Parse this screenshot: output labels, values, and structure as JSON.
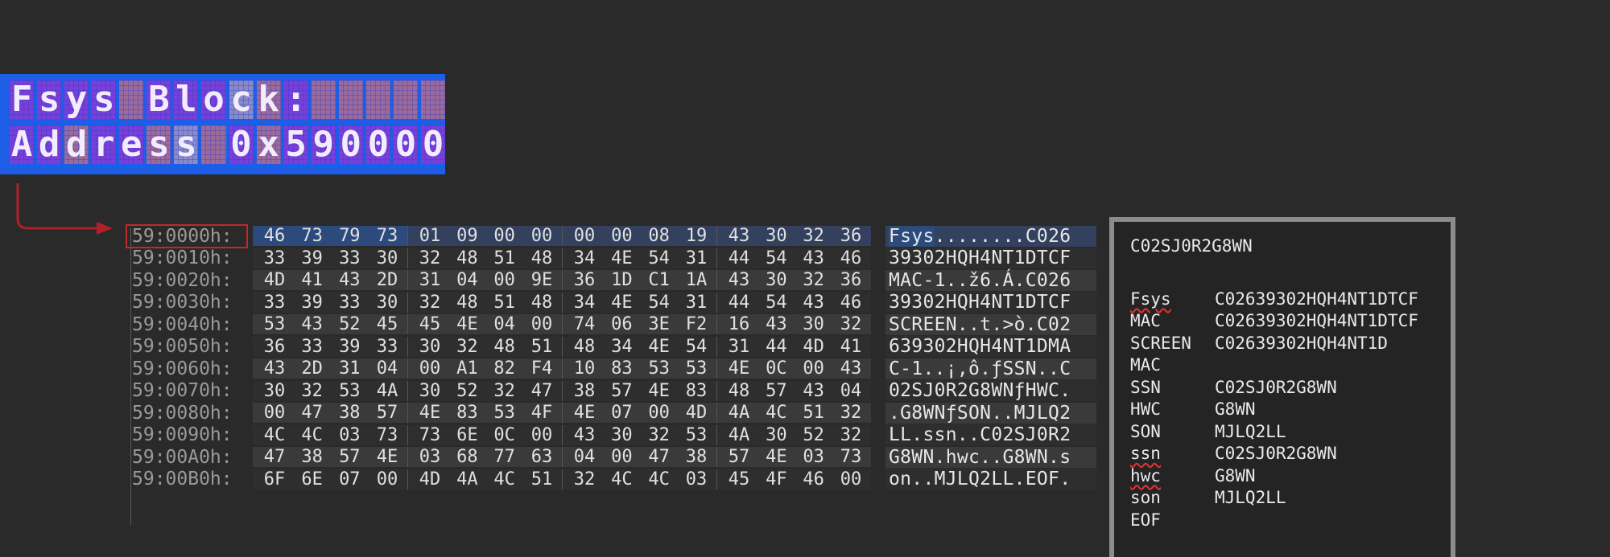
{
  "lcd": {
    "line1": [
      "F",
      "s",
      "y",
      "s",
      " ",
      "B",
      "l",
      "o",
      "c",
      "k",
      ":",
      " ",
      " ",
      " ",
      " ",
      " "
    ],
    "line2": [
      "A",
      "d",
      "d",
      "r",
      "e",
      "s",
      "s",
      " ",
      "0",
      "x",
      "5",
      "9",
      "0",
      "0",
      "0",
      "0"
    ]
  },
  "hex": {
    "rows": [
      {
        "addr": "59:0000h:",
        "bytes": [
          "46",
          "73",
          "79",
          "73",
          "01",
          "09",
          "00",
          "00",
          "00",
          "00",
          "08",
          "19",
          "43",
          "30",
          "32",
          "36"
        ],
        "ascii_hl": "Fsys",
        "ascii": "........C026"
      },
      {
        "addr": "59:0010h:",
        "bytes": [
          "33",
          "39",
          "33",
          "30",
          "32",
          "48",
          "51",
          "48",
          "34",
          "4E",
          "54",
          "31",
          "44",
          "54",
          "43",
          "46"
        ],
        "ascii_hl": "",
        "ascii": "39302HQH4NT1DTCF"
      },
      {
        "addr": "59:0020h:",
        "bytes": [
          "4D",
          "41",
          "43",
          "2D",
          "31",
          "04",
          "00",
          "9E",
          "36",
          "1D",
          "C1",
          "1A",
          "43",
          "30",
          "32",
          "36"
        ],
        "ascii_hl": "",
        "ascii": "MAC-1..ž6.Á.C026"
      },
      {
        "addr": "59:0030h:",
        "bytes": [
          "33",
          "39",
          "33",
          "30",
          "32",
          "48",
          "51",
          "48",
          "34",
          "4E",
          "54",
          "31",
          "44",
          "54",
          "43",
          "46"
        ],
        "ascii_hl": "",
        "ascii": "39302HQH4NT1DTCF"
      },
      {
        "addr": "59:0040h:",
        "bytes": [
          "53",
          "43",
          "52",
          "45",
          "45",
          "4E",
          "04",
          "00",
          "74",
          "06",
          "3E",
          "F2",
          "16",
          "43",
          "30",
          "32"
        ],
        "ascii_hl": "",
        "ascii": "SCREEN..t.>ò.C02"
      },
      {
        "addr": "59:0050h:",
        "bytes": [
          "36",
          "33",
          "39",
          "33",
          "30",
          "32",
          "48",
          "51",
          "48",
          "34",
          "4E",
          "54",
          "31",
          "44",
          "4D",
          "41"
        ],
        "ascii_hl": "",
        "ascii": "639302HQH4NT1DMA"
      },
      {
        "addr": "59:0060h:",
        "bytes": [
          "43",
          "2D",
          "31",
          "04",
          "00",
          "A1",
          "82",
          "F4",
          "10",
          "83",
          "53",
          "53",
          "4E",
          "0C",
          "00",
          "43"
        ],
        "ascii_hl": "",
        "ascii": "C-1..¡,ô.ƒSSN..C"
      },
      {
        "addr": "59:0070h:",
        "bytes": [
          "30",
          "32",
          "53",
          "4A",
          "30",
          "52",
          "32",
          "47",
          "38",
          "57",
          "4E",
          "83",
          "48",
          "57",
          "43",
          "04"
        ],
        "ascii_hl": "",
        "ascii": "02SJ0R2G8WNƒHWC."
      },
      {
        "addr": "59:0080h:",
        "bytes": [
          "00",
          "47",
          "38",
          "57",
          "4E",
          "83",
          "53",
          "4F",
          "4E",
          "07",
          "00",
          "4D",
          "4A",
          "4C",
          "51",
          "32"
        ],
        "ascii_hl": "",
        "ascii": ".G8WNƒSON..MJLQ2"
      },
      {
        "addr": "59:0090h:",
        "bytes": [
          "4C",
          "4C",
          "03",
          "73",
          "73",
          "6E",
          "0C",
          "00",
          "43",
          "30",
          "32",
          "53",
          "4A",
          "30",
          "52",
          "32"
        ],
        "ascii_hl": "",
        "ascii": "LL.ssn..C02SJ0R2"
      },
      {
        "addr": "59:00A0h:",
        "bytes": [
          "47",
          "38",
          "57",
          "4E",
          "03",
          "68",
          "77",
          "63",
          "04",
          "00",
          "47",
          "38",
          "57",
          "4E",
          "03",
          "73"
        ],
        "ascii_hl": "",
        "ascii": "G8WN.hwc..G8WN.s"
      },
      {
        "addr": "59:00B0h:",
        "bytes": [
          "6F",
          "6E",
          "07",
          "00",
          "4D",
          "4A",
          "4C",
          "51",
          "32",
          "4C",
          "4C",
          "03",
          "45",
          "4F",
          "46",
          "00"
        ],
        "ascii_hl": "",
        "ascii": "on..MJLQ2LL.EOF."
      }
    ]
  },
  "info": {
    "serial": "C02SJ0R2G8WN",
    "fields": [
      {
        "key": "Fsys",
        "value": "C02639302HQH4NT1DTCF",
        "squiggle": true
      },
      {
        "key": "MAC",
        "value": "C02639302HQH4NT1DTCF",
        "squiggle": false
      },
      {
        "key": "SCREEN",
        "value": "C02639302HQH4NT1D",
        "squiggle": false
      },
      {
        "key": "MAC",
        "value": "",
        "squiggle": false
      },
      {
        "key": "SSN",
        "value": "C02SJ0R2G8WN",
        "squiggle": false
      },
      {
        "key": "HWC",
        "value": "G8WN",
        "squiggle": false
      },
      {
        "key": "SON",
        "value": "MJLQ2LL",
        "squiggle": false
      },
      {
        "key": "ssn",
        "value": "C02SJ0R2G8WN",
        "squiggle": true
      },
      {
        "key": "hwc",
        "value": "G8WN",
        "squiggle": true
      },
      {
        "key": "son",
        "value": "MJLQ2LL",
        "squiggle": false
      },
      {
        "key": "EOF",
        "value": "",
        "squiggle": false
      }
    ]
  },
  "colors": {
    "lcd_bg": "#1e5ee6",
    "arrow": "#b0202a",
    "highlight": "#2d4a7c"
  }
}
